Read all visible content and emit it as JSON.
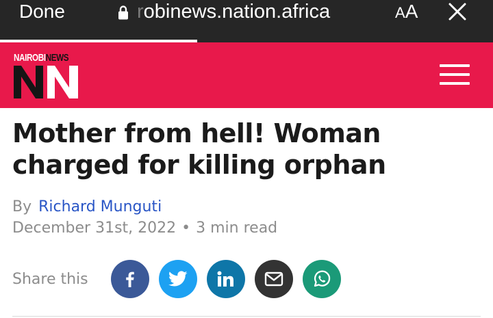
{
  "browser": {
    "done_label": "Done",
    "url_clipped": "r",
    "url": "obinews.nation.africa",
    "text_size_small": "A",
    "text_size_large": "A"
  },
  "site": {
    "logo_part1": "NAIROBI",
    "logo_part2": "NEWS",
    "logo_mark": "NN",
    "brand_color": "#e8194b"
  },
  "article": {
    "title": "Mother from hell! Woman charged for killing orphan",
    "by_label": "By",
    "author": "Richard Munguti",
    "date": "December 31st, 2022",
    "separator": "•",
    "read_time": "3 min read"
  },
  "share": {
    "label": "Share this",
    "buttons": [
      {
        "icon": "facebook-icon",
        "color": "#3b5998"
      },
      {
        "icon": "twitter-icon",
        "color": "#1da1f2"
      },
      {
        "icon": "linkedin-icon",
        "color": "#0e76a8"
      },
      {
        "icon": "email-icon",
        "color": "#333333"
      },
      {
        "icon": "whatsapp-icon",
        "color": "#1b9a78"
      }
    ]
  }
}
